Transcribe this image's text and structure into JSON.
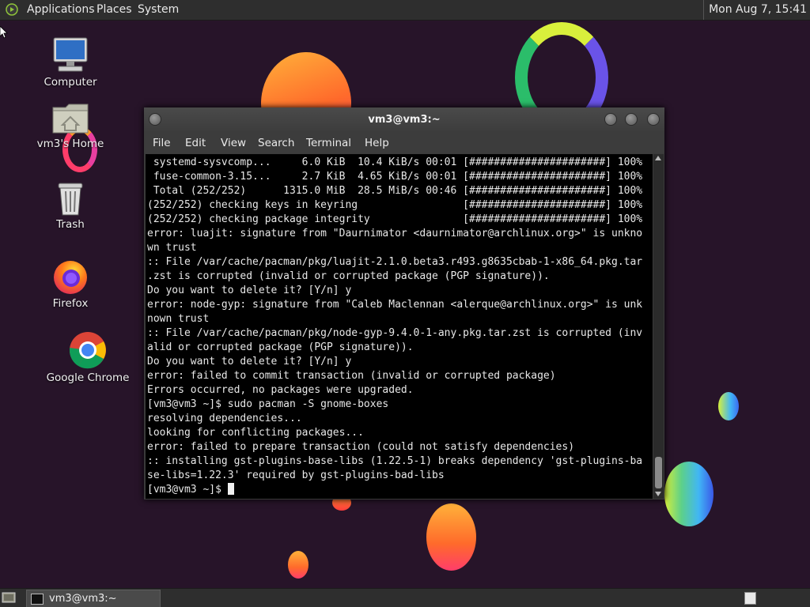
{
  "top_panel": {
    "menus": [
      "Applications",
      "Places",
      "System"
    ],
    "clock": "Mon Aug  7, 15:41"
  },
  "desktop_icons": [
    {
      "label": "Computer",
      "icon": "computer-icon"
    },
    {
      "label": "vm3's Home",
      "icon": "home-folder-icon"
    },
    {
      "label": "Trash",
      "icon": "trash-icon"
    },
    {
      "label": "Firefox",
      "icon": "firefox-icon"
    },
    {
      "label": "Google Chrome",
      "icon": "chrome-icon"
    }
  ],
  "terminal": {
    "title": "vm3@vm3:~",
    "menu": [
      "File",
      "Edit",
      "View",
      "Search",
      "Terminal",
      "Help"
    ],
    "lines": [
      " systemd-sysvcomp...     6.0 KiB  10.4 KiB/s 00:01 [######################] 100%",
      " fuse-common-3.15...     2.7 KiB  4.65 KiB/s 00:01 [######################] 100%",
      " Total (252/252)      1315.0 MiB  28.5 MiB/s 00:46 [######################] 100%",
      "(252/252) checking keys in keyring                 [######################] 100%",
      "(252/252) checking package integrity               [######################] 100%",
      "error: luajit: signature from \"Daurnimator <daurnimator@archlinux.org>\" is unkno",
      "wn trust",
      ":: File /var/cache/pacman/pkg/luajit-2.1.0.beta3.r493.g8635cbab-1-x86_64.pkg.tar",
      ".zst is corrupted (invalid or corrupted package (PGP signature)).",
      "Do you want to delete it? [Y/n] y",
      "error: node-gyp: signature from \"Caleb Maclennan <alerque@archlinux.org>\" is unk",
      "nown trust",
      ":: File /var/cache/pacman/pkg/node-gyp-9.4.0-1-any.pkg.tar.zst is corrupted (inv",
      "alid or corrupted package (PGP signature)).",
      "Do you want to delete it? [Y/n] y",
      "error: failed to commit transaction (invalid or corrupted package)",
      "Errors occurred, no packages were upgraded.",
      "[vm3@vm3 ~]$ sudo pacman -S gnome-boxes",
      "resolving dependencies...",
      "looking for conflicting packages...",
      "error: failed to prepare transaction (could not satisfy dependencies)",
      ":: installing gst-plugins-base-libs (1.22.5-1) breaks dependency 'gst-plugins-ba",
      "se-libs=1.22.3' required by gst-plugins-bad-libs"
    ],
    "prompt": "[vm3@vm3 ~]$ "
  },
  "bottom_panel": {
    "task_label": "vm3@vm3:~"
  },
  "colors": {
    "desktop_bg": "#271429",
    "panel_bg": "#2e2e2e",
    "terminal_bg": "#000000",
    "terminal_fg": "#e8e8e8"
  }
}
